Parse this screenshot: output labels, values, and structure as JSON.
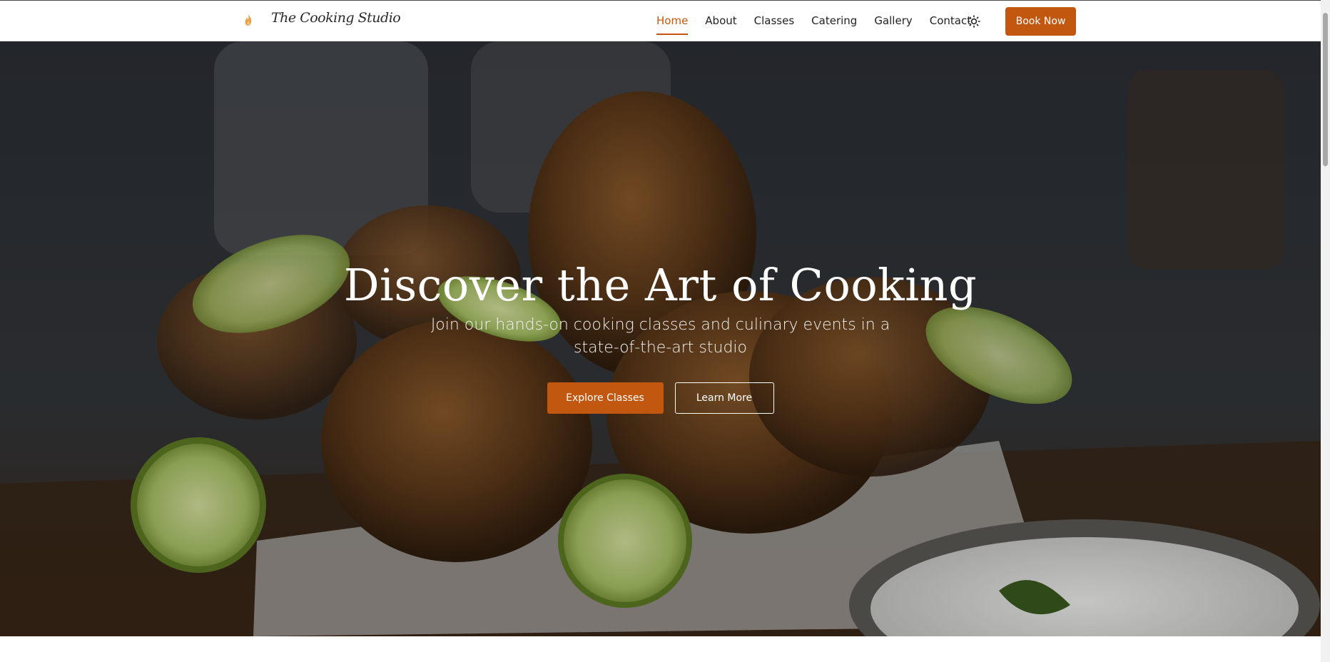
{
  "brand": {
    "name": "The Cooking Studio",
    "logo_icon": "flame-icon",
    "accent_color": "#c2580f"
  },
  "nav": {
    "items": [
      {
        "label": "Home",
        "active": true
      },
      {
        "label": "About",
        "active": false
      },
      {
        "label": "Classes",
        "active": false
      },
      {
        "label": "Catering",
        "active": false
      },
      {
        "label": "Gallery",
        "active": false
      },
      {
        "label": "Contact",
        "active": false
      }
    ],
    "theme_toggle_icon": "sun-icon",
    "book_button": "Book Now"
  },
  "hero": {
    "title": "Discover the Art of Cooking",
    "subtitle": "Join our hands-on cooking classes and culinary events in a state-of-the-art studio",
    "primary_button": "Explore Classes",
    "secondary_button": "Learn More"
  }
}
